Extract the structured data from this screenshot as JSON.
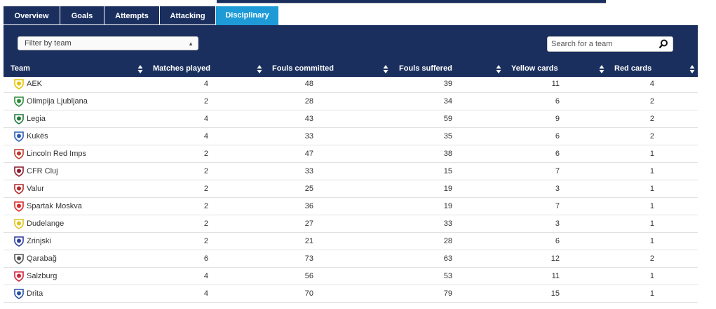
{
  "tabs": [
    {
      "label": "Overview",
      "active": false
    },
    {
      "label": "Goals",
      "active": false
    },
    {
      "label": "Attempts",
      "active": false
    },
    {
      "label": "Attacking",
      "active": false
    },
    {
      "label": "Disciplinary",
      "active": true
    }
  ],
  "filter": {
    "label": "Filter by team"
  },
  "search": {
    "placeholder": "Search for a team"
  },
  "columns": [
    "Team",
    "Matches played",
    "Fouls committed",
    "Fouls suffered",
    "Yellow cards",
    "Red cards"
  ],
  "rows": [
    {
      "team": "AEK",
      "matches": "4",
      "fouls_committed": "48",
      "fouls_suffered": "39",
      "yellow": "11",
      "red": "4",
      "color": "#e6c300"
    },
    {
      "team": "Olimpija Ljubljana",
      "matches": "2",
      "fouls_committed": "28",
      "fouls_suffered": "34",
      "yellow": "6",
      "red": "2",
      "color": "#2e8b3d"
    },
    {
      "team": "Legia",
      "matches": "4",
      "fouls_committed": "43",
      "fouls_suffered": "59",
      "yellow": "9",
      "red": "2",
      "color": "#1f7a3a"
    },
    {
      "team": "Kukës",
      "matches": "4",
      "fouls_committed": "33",
      "fouls_suffered": "35",
      "yellow": "6",
      "red": "2",
      "color": "#2a5db0"
    },
    {
      "team": "Lincoln Red Imps",
      "matches": "2",
      "fouls_committed": "47",
      "fouls_suffered": "38",
      "yellow": "6",
      "red": "1",
      "color": "#c0392b"
    },
    {
      "team": "CFR Cluj",
      "matches": "2",
      "fouls_committed": "33",
      "fouls_suffered": "15",
      "yellow": "7",
      "red": "1",
      "color": "#8b1c2c"
    },
    {
      "team": "Valur",
      "matches": "2",
      "fouls_committed": "25",
      "fouls_suffered": "19",
      "yellow": "3",
      "red": "1",
      "color": "#b22a2a"
    },
    {
      "team": "Spartak Moskva",
      "matches": "2",
      "fouls_committed": "36",
      "fouls_suffered": "19",
      "yellow": "7",
      "red": "1",
      "color": "#d62828"
    },
    {
      "team": "Dudelange",
      "matches": "2",
      "fouls_committed": "27",
      "fouls_suffered": "33",
      "yellow": "3",
      "red": "1",
      "color": "#e0c21a"
    },
    {
      "team": "Zrinjski",
      "matches": "2",
      "fouls_committed": "21",
      "fouls_suffered": "28",
      "yellow": "6",
      "red": "1",
      "color": "#2c3e9e"
    },
    {
      "team": "Qarabağ",
      "matches": "6",
      "fouls_committed": "73",
      "fouls_suffered": "63",
      "yellow": "12",
      "red": "2",
      "color": "#555555"
    },
    {
      "team": "Salzburg",
      "matches": "4",
      "fouls_committed": "56",
      "fouls_suffered": "53",
      "yellow": "11",
      "red": "1",
      "color": "#d0213a"
    },
    {
      "team": "Drita",
      "matches": "4",
      "fouls_committed": "70",
      "fouls_suffered": "79",
      "yellow": "15",
      "red": "1",
      "color": "#2a4fa8"
    }
  ],
  "colors": {
    "navy": "#1a2f5e",
    "active_tab": "#1e9bd7"
  }
}
